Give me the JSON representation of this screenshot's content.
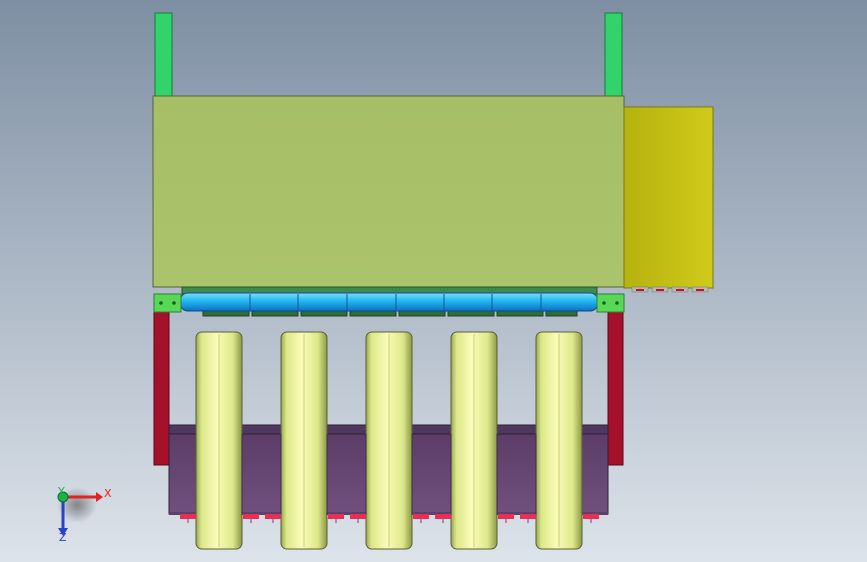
{
  "viewport": {
    "background_top": "#7e8fa3",
    "background_bottom": "#dde3ea"
  },
  "colors": {
    "upright_green": "#33d36b",
    "main_body": "#a8c06a",
    "side_box": "#c7c214",
    "blue_roller": "#21b7f0",
    "bracket_green": "#59d858",
    "side_frame_red": "#a5102a",
    "wheel_yellow": "#f2f7a2",
    "base_purple": "#6a4a78",
    "dark_green_blocks": "#2f6c39",
    "red_nuts": "#ea2e57"
  },
  "triad": {
    "x_label": "X",
    "y_label": "Y",
    "z_label": "Z",
    "x_color": "#e32323",
    "y_color": "#19b24b",
    "z_color": "#2744c8"
  }
}
